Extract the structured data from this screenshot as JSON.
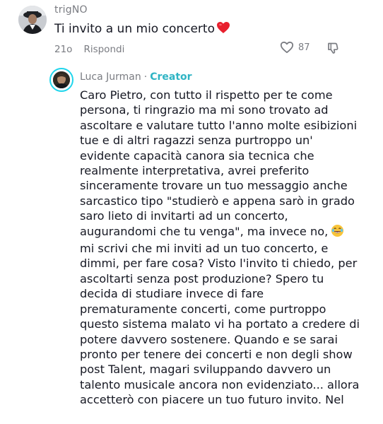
{
  "top_comment": {
    "username": "trigNO",
    "text": "Ti invito a un mio concerto",
    "emoji": "heart-emoji",
    "time": "21o",
    "reply_label": "Rispondi",
    "like_count": "87"
  },
  "reply": {
    "username": "Luca Jurman",
    "separator": "·",
    "badge": "Creator",
    "lines": [
      "Caro Pietro, con tutto il rispetto per te come",
      "persona, ti ringrazio ma mi sono trovato ad",
      "ascoltare e valutare tutto l'anno molte esibizioni",
      "tue e di altri ragazzi senza purtroppo un'",
      "evidente capacità canora sia tecnica che",
      "realmente interpretativa, avrei preferito",
      "sinceramente trovare un tuo messaggio anche",
      "sarcastico tipo \"studierò e appena sarò in grado",
      "saro lieto di invitarti ad un concerto,",
      "augurandomi che tu venga\", ma invece no,",
      "mi scrivi che mi inviti ad un tuo concerto, e",
      "dimmi, per fare cosa? Visto l'invito ti chiedo, per",
      "ascoltarti senza post produzione? Spero tu",
      "decida di studiare invece di fare",
      "prematuramente concerti, come purtroppo",
      "questo sistema malato vi ha portato a credere di",
      "potere davvero sostenere. Quando e se sarai",
      "pronto per tenere dei concerti e non degli show",
      "post Talent, magari sviluppando davvero un",
      "talento musicale ancora non evidenziato... allora",
      "accetterò con piacere un tuo futuro invito. Nel"
    ],
    "laugh_emoji": "laughing-emoji"
  },
  "colors": {
    "text": "#161823",
    "muted": "#7a7c82",
    "creator": "#2fb4c4",
    "ring": "#20d5ec",
    "heart": "#e8202e"
  }
}
